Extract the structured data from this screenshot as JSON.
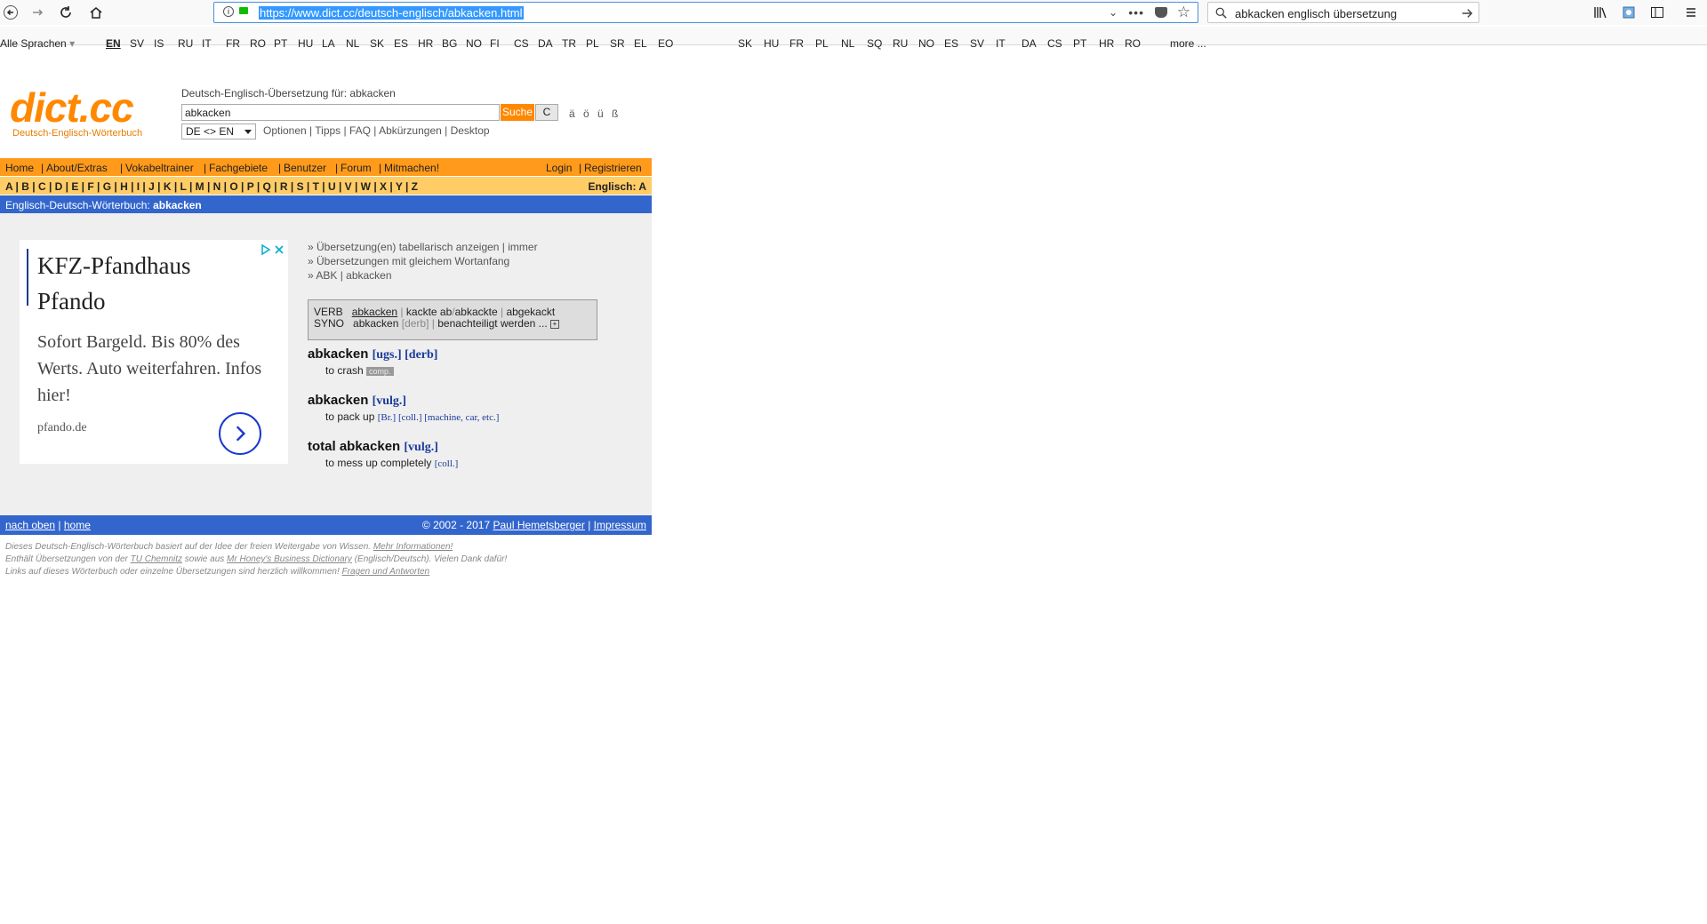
{
  "browser": {
    "url": "https://www.dict.cc/deutsch-englisch/abkacken.html",
    "search_query": "abkacken englisch übersetzung",
    "lang_menu_label": "Alle Sprachen",
    "langs_group1": [
      "EN",
      "SV",
      "IS",
      "RU",
      "IT",
      "FR",
      "RO",
      "PT",
      "HU",
      "LA",
      "NL",
      "SK",
      "ES",
      "HR",
      "BG",
      "NO",
      "FI",
      "CS",
      "DA",
      "TR",
      "PL",
      "SR",
      "EL",
      "EO"
    ],
    "langs_group2": [
      "SK",
      "HU",
      "FR",
      "PL",
      "NL",
      "SQ",
      "RU",
      "NO",
      "ES",
      "SV",
      "IT",
      "DA",
      "CS",
      "PT",
      "HR",
      "RO"
    ],
    "more_label": "more ..."
  },
  "header": {
    "logo": "dict.cc",
    "logo_sub": "Deutsch-Englisch-Wörterbuch",
    "search_label": "Deutsch-Englisch-Übersetzung für: abkacken",
    "query": "abkacken",
    "search_button": "Suche",
    "clear_button": "C",
    "umlauts": "ä ö ü ß",
    "direction": "DE <> EN",
    "options_links": "Optionen | Tipps | FAQ | Abkürzungen | Desktop"
  },
  "nav": {
    "left": [
      "Home",
      "About/Extras",
      "Vokabeltrainer",
      "Fachgebiete",
      "Benutzer",
      "Forum",
      "Mitmachen!"
    ],
    "right": [
      "Login",
      "Registrieren"
    ],
    "alphabet": "A | B | C | D | E | F | G | H | I | J | K | L | M | N | O | P | Q | R | S | T | U | V | W | X | Y | Z",
    "alphabet_right": "Englisch: A",
    "bluebar_prefix": "Englisch-Deutsch-Wörterbuch: ",
    "bluebar_term": "abkacken"
  },
  "ad": {
    "title1": "KFZ-Pfandhaus",
    "title2": "Pfando",
    "body": "Sofort Bargeld. Bis 80% des Werts. Auto weiterfahren. Infos hier!",
    "domain": "pfando.de"
  },
  "links_top": [
    "» Übersetzung(en) tabellarisch anzeigen | immer",
    "» Übersetzungen mit gleichem Wortanfang",
    "» ABK | abkacken"
  ],
  "verbbox": {
    "verb_label": "VERB",
    "verb_main": "abkacken",
    "verb_rest1": "kackte ab",
    "verb_rest2": "abkackte",
    "verb_rest3": "abgekackt",
    "syno_label": "SYNO",
    "syno_main": "abkacken",
    "syno_tag": "[derb]",
    "syno_rest": "benachteiligt werden ..."
  },
  "entries": [
    {
      "head": "abkacken",
      "tags": "[ugs.] [derb]",
      "trans": "to crash",
      "trans_tags": "",
      "badge": "comp."
    },
    {
      "head": "abkacken",
      "tags": "[vulg.]",
      "trans": "to pack up",
      "trans_tags": "[Br.] [coll.] [machine, car, etc.]",
      "badge": ""
    },
    {
      "head": "total abkacken",
      "tags": "[vulg.]",
      "trans": "to mess up completely",
      "trans_tags": "[coll.]",
      "badge": ""
    }
  ],
  "footer": {
    "left_top": "nach oben",
    "left_home": "home",
    "copyright": "© 2002 - 2017 ",
    "author": "Paul Hemetsberger",
    "impressum": "Impressum",
    "line1": "Dieses Deutsch-Englisch-Wörterbuch basiert auf der Idee der freien Weitergabe von Wissen.",
    "line1_link": "Mehr Informationen!",
    "line2a": "Enthält Übersetzungen von der",
    "line2_link1": "TU Chemnitz",
    "line2b": "sowie aus",
    "line2_link2": "Mr Honey's Business Dictionary",
    "line2c": "(Englisch/Deutsch). Vielen Dank dafür!",
    "line3": "Links auf dieses Wörterbuch oder einzelne Übersetzungen sind herzlich willkommen!",
    "line3_link": "Fragen und Antworten"
  }
}
